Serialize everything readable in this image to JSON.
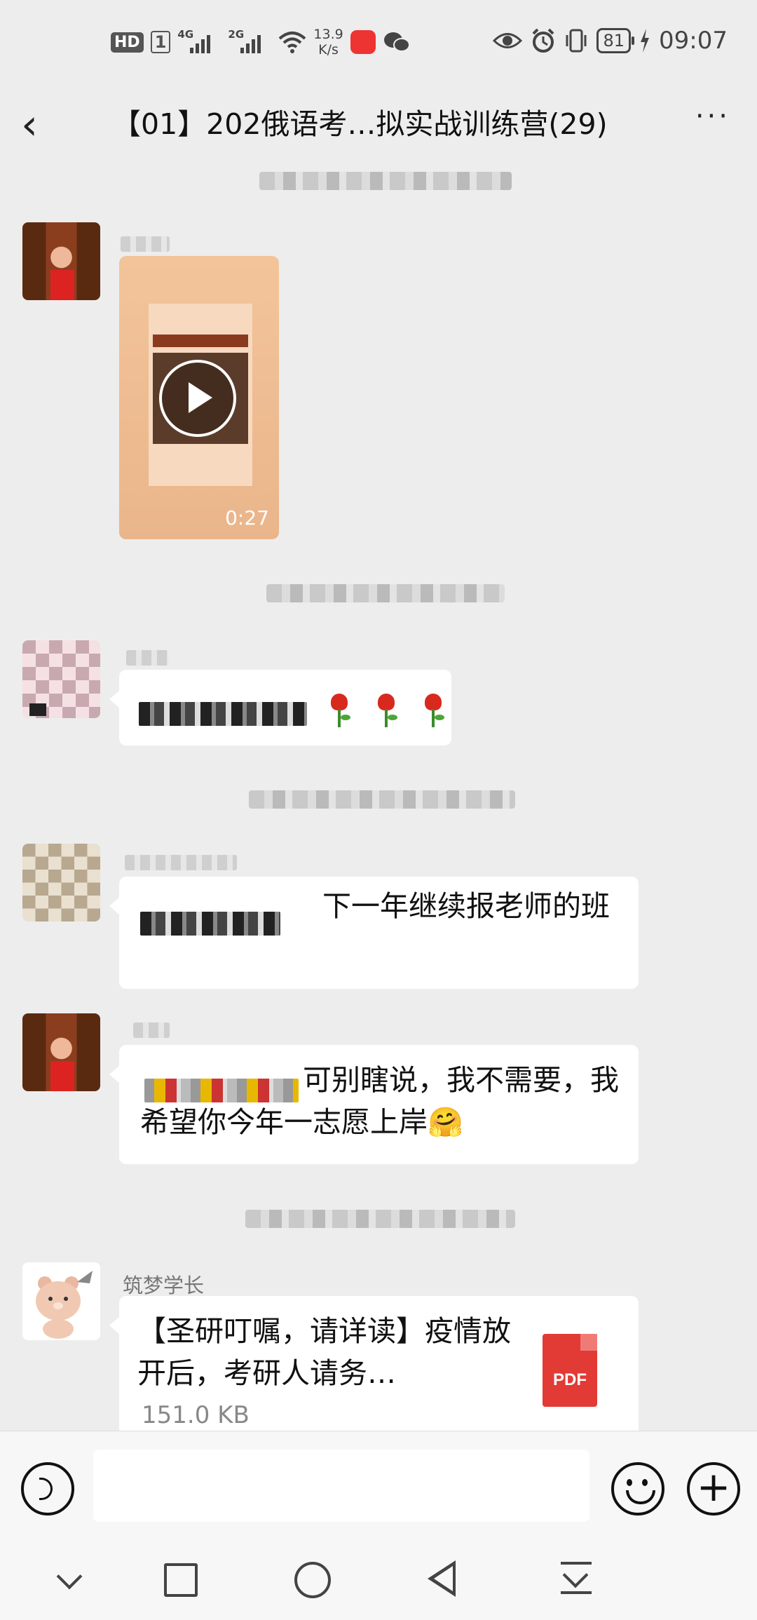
{
  "status_bar": {
    "hd_label": "HD",
    "sim_label": "1",
    "net1_label": "4G",
    "net2_label": "2G",
    "speed_value": "13.9",
    "speed_unit": "K/s",
    "battery": "81",
    "time": "09:07"
  },
  "header": {
    "back_label": "‹",
    "title": "【01】202俄语考…拟实战训练营(29)",
    "more_label": "···"
  },
  "messages": {
    "video": {
      "duration": "0:27"
    },
    "msg2": {},
    "msg3": {
      "text": "下一年继续报老师的班"
    },
    "msg4": {
      "text": "可别瞎说，我不需要，我希望你今年一志愿上岸🤗"
    },
    "file_message": {
      "sender": "筑梦学长",
      "file_name": "【圣研叮嘱，请详读】疫情放开后，考研人请务…",
      "file_size": "151.0 KB",
      "file_type": "PDF"
    }
  },
  "input_bar": {
    "plus_label": "+"
  },
  "colors": {
    "background": "#ededed",
    "bubble": "#ffffff",
    "pdf_red": "#e23a35"
  }
}
